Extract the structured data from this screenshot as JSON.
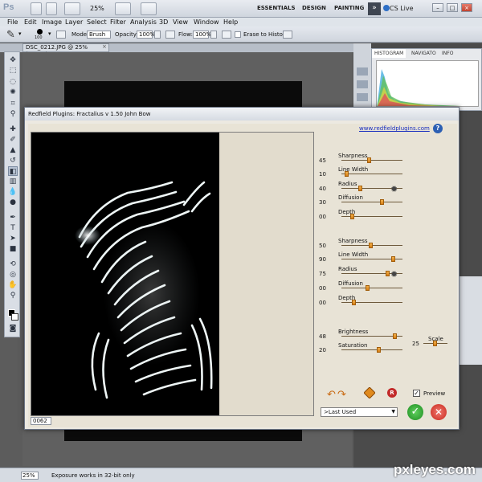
{
  "app": {
    "logo_text": "Ps",
    "zoom_level": "25%",
    "workspaces": [
      "ESSENTIALS",
      "DESIGN",
      "PAINTING"
    ],
    "more_workspaces": "»",
    "cs_live": "CS Live",
    "window_controls": [
      "–",
      "□",
      "×"
    ]
  },
  "menu": [
    "File",
    "Edit",
    "Image",
    "Layer",
    "Select",
    "Filter",
    "Analysis",
    "3D",
    "View",
    "Window",
    "Help"
  ],
  "options_bar": {
    "mode_label": "Mode:",
    "mode_value": "Brush",
    "opacity_label": "Opacity:",
    "opacity_value": "100%",
    "flow_label": "Flow:",
    "flow_value": "100%",
    "erase_history_label": "Erase to History",
    "brush_size": "100"
  },
  "document_tab": {
    "title": "DSC_0212.JPG @ 25% (RGB/8)",
    "close": "×"
  },
  "panels": {
    "tabs": [
      "HISTOGRAM",
      "NAVIGATO",
      "INFO"
    ],
    "histogram_colors": [
      "#3aa8e0",
      "#62c052",
      "#e0d540",
      "#e24a5a"
    ]
  },
  "status": {
    "zoom": "25%",
    "message": "Exposure works in 32-bit only"
  },
  "watermark": "pxleyes.com",
  "dialog": {
    "title": "Redfield Plugins: Fractalius v 1.50   John Bow",
    "site_link": "www.redfieldplugins.com",
    "help": "?",
    "preview_code": "0062",
    "group1": [
      {
        "label": "Sharpness",
        "value": "45",
        "level": 0.45
      },
      {
        "label": "Line Width",
        "value": "10",
        "level": 0.05
      },
      {
        "label": "Radius",
        "value": "40",
        "level": 0.3
      },
      {
        "label": "Diffusion",
        "value": "30",
        "level": 0.68
      },
      {
        "label": "Depth",
        "value": "00",
        "level": 0.15
      }
    ],
    "group2": [
      {
        "label": "Sharpness",
        "value": "50",
        "level": 0.48
      },
      {
        "label": "Line Width",
        "value": "90",
        "level": 0.88
      },
      {
        "label": "Radius",
        "value": "75",
        "level": 0.78
      },
      {
        "label": "Diffusion",
        "value": "00",
        "level": 0.42
      },
      {
        "label": "Depth",
        "value": "00",
        "level": 0.18
      }
    ],
    "brightness": {
      "label": "Brightness",
      "value": "48",
      "level": 0.9
    },
    "saturation": {
      "label": "Saturation",
      "value": "20",
      "level": 0.62
    },
    "scale": {
      "label": "Scale",
      "value": "25",
      "level": 0.48
    },
    "preview_label": "Preview",
    "preview_checked": "✓",
    "reset_icon": "R",
    "preset": ">Last Used",
    "ok": "✓",
    "cancel": "✕",
    "accent_color": "#e08a1e"
  }
}
